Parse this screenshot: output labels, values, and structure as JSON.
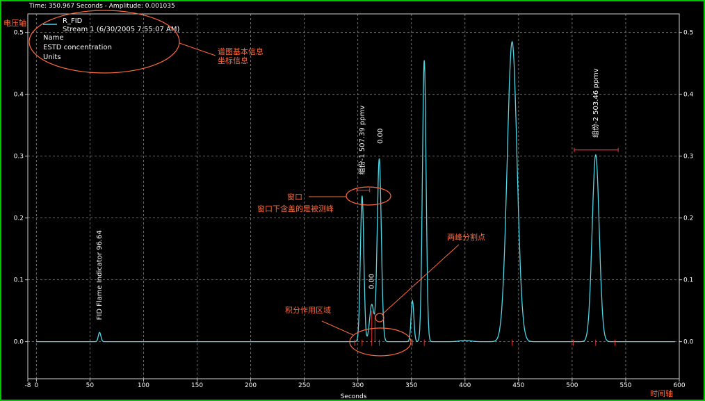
{
  "header": {
    "readout": "Time: 350.967 Seconds - Amplitude: 0.001035"
  },
  "legend": {
    "series": "R_FID",
    "stream": "Stream 1 (6/30/2005 7:55:07 AM)",
    "lines": [
      "Name",
      "ESTD concentration",
      "Units"
    ]
  },
  "annotations": {
    "voltage_axis": "电压轴",
    "time_axis": "时间轴",
    "info_1": "谱图基本信息",
    "info_2": "坐标信息",
    "window": "窗口",
    "window_note": "窗口下含盖的是被测峰",
    "split_point": "两峰分割点",
    "integration": "积分作用区域"
  },
  "colors": {
    "trace": "#4fd8e8",
    "grid": "#8a8a8a",
    "annotation": "#ff6a3d",
    "marker": "#e03030",
    "frame": "#00c800"
  },
  "chart_data": {
    "type": "line",
    "xlabel": "Seconds",
    "ylabel": "",
    "xlim": [
      -8,
      600
    ],
    "ylim": [
      -0.06,
      0.53
    ],
    "x_ticks": [
      "-8",
      "0",
      "50",
      "100",
      "150",
      "200",
      "250",
      "300",
      "350",
      "400",
      "450",
      "500",
      "550",
      "600"
    ],
    "y_ticks_left": [
      "0.5",
      "0.4",
      "0.3",
      "0.2",
      "0.1",
      "0.0"
    ],
    "y_ticks_right": [
      "0.5",
      "0.4",
      "0.3",
      "0.2",
      "0.1",
      "0.0"
    ],
    "grid": true,
    "series": [
      {
        "name": "R_FID",
        "peaks": [
          {
            "rt": 59,
            "height": 0.015,
            "width": 1.2
          },
          {
            "rt": 304,
            "height": 0.236,
            "width": 1.6
          },
          {
            "rt": 313,
            "height": 0.06,
            "width": 2.0
          },
          {
            "rt": 320,
            "height": 0.296,
            "width": 1.9
          },
          {
            "rt": 351,
            "height": 0.066,
            "width": 1.3
          },
          {
            "rt": 362,
            "height": 0.455,
            "width": 1.7
          },
          {
            "rt": 444,
            "height": 0.485,
            "width": 4.6
          },
          {
            "rt": 522,
            "height": 0.302,
            "width": 3.3
          },
          {
            "rt": 400,
            "height": 0.002,
            "width": 5.0
          }
        ]
      }
    ],
    "peak_labels": [
      {
        "x": 59,
        "y": 0.035,
        "text": "FID Flame Indicator  96.64"
      },
      {
        "x": 304,
        "y": 0.27,
        "text": "组份-1   507.39 ppmv"
      },
      {
        "x": 321,
        "y": 0.32,
        "text": "0.00"
      },
      {
        "x": 313,
        "y": 0.085,
        "text": "0.00"
      },
      {
        "x": 522,
        "y": 0.33,
        "text": "组份-2   503.46 ppmv"
      }
    ],
    "windows": [
      {
        "x0": 299,
        "x1": 311,
        "y": 0.245
      },
      {
        "x0": 502,
        "x1": 543,
        "y": 0.31
      }
    ]
  }
}
